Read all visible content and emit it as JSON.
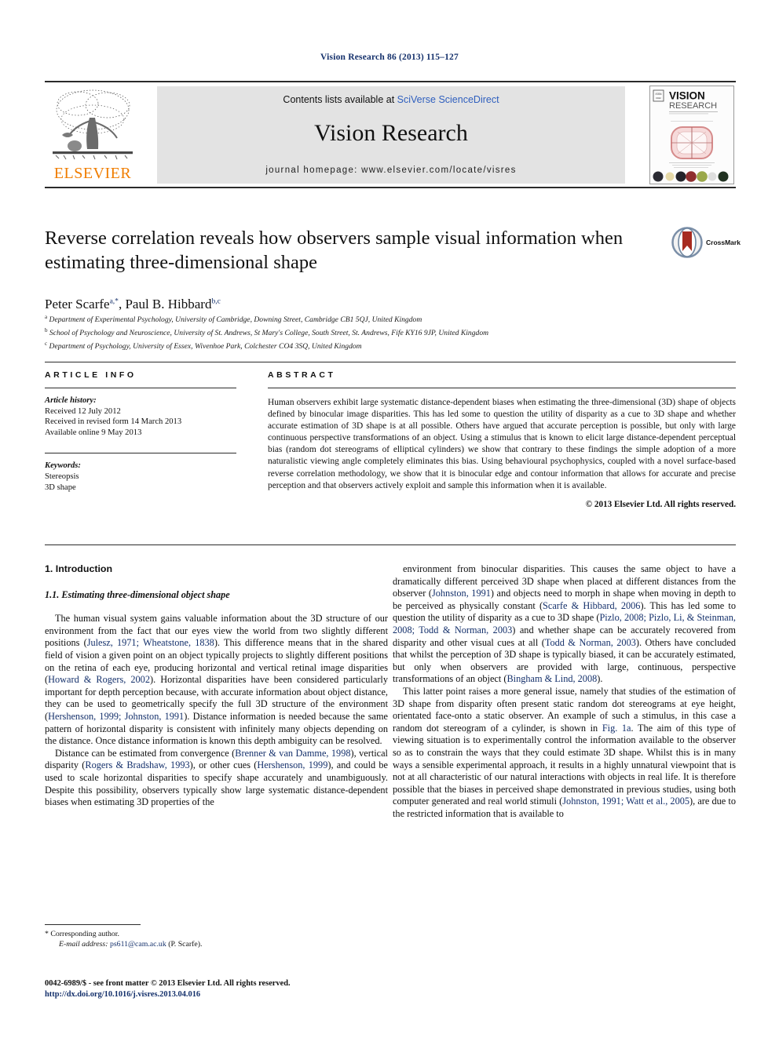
{
  "running_head": "Vision Research 86 (2013) 115–127",
  "masthead": {
    "elsevier_wordmark": "ELSEVIER",
    "contents_prefix": "Contents lists available at ",
    "contents_link": "SciVerse ScienceDirect",
    "journal_title": "Vision Research",
    "homepage": "journal homepage: www.elsevier.com/locate/visres",
    "cover": {
      "line1": "VISION",
      "line2": "RESEARCH",
      "tagline": "An international journal for functional aspects of vision"
    }
  },
  "article": {
    "title": "Reverse correlation reveals how observers sample visual information when estimating three-dimensional shape",
    "crossmark_label": "CrossMark",
    "authors": [
      {
        "name": "Peter Scarfe",
        "marks": "a,*"
      },
      {
        "name": "Paul B. Hibbard",
        "marks": "b,c"
      }
    ],
    "authors_line": "Peter Scarfe a,*, Paul B. Hibbard b,c",
    "affiliations": [
      {
        "mark": "a",
        "text": "Department of Experimental Psychology, University of Cambridge, Downing Street, Cambridge CB1 5QJ, United Kingdom"
      },
      {
        "mark": "b",
        "text": "School of Psychology and Neuroscience, University of St. Andrews, St Mary's College, South Street, St. Andrews, Fife KY16 9JP, United Kingdom"
      },
      {
        "mark": "c",
        "text": "Department of Psychology, University of Essex, Wivenhoe Park, Colchester CO4 3SQ, United Kingdom"
      }
    ]
  },
  "article_info": {
    "heading": "ARTICLE INFO",
    "history_label": "Article history:",
    "history": [
      "Received 12 July 2012",
      "Received in revised form 14 March 2013",
      "Available online 9 May 2013"
    ],
    "keywords_label": "Keywords:",
    "keywords": [
      "Stereopsis",
      "3D shape"
    ]
  },
  "abstract": {
    "heading": "ABSTRACT",
    "text": "Human observers exhibit large systematic distance-dependent biases when estimating the three-dimensional (3D) shape of objects defined by binocular image disparities. This has led some to question the utility of disparity as a cue to 3D shape and whether accurate estimation of 3D shape is at all possible. Others have argued that accurate perception is possible, but only with large continuous perspective transformations of an object. Using a stimulus that is known to elicit large distance-dependent perceptual bias (random dot stereograms of elliptical cylinders) we show that contrary to these findings the simple adoption of a more naturalistic viewing angle completely eliminates this bias. Using behavioural psychophysics, coupled with a novel surface-based reverse correlation methodology, we show that it is binocular edge and contour information that allows for accurate and precise perception and that observers actively exploit and sample this information when it is available.",
    "copyright": "© 2013 Elsevier Ltd. All rights reserved."
  },
  "body": {
    "section_number_title": "1. Introduction",
    "subsection_title": "1.1. Estimating three-dimensional object shape",
    "left_column": [
      {
        "segments": [
          {
            "t": "The human visual system gains valuable information about the 3D structure of our environment from the fact that our eyes view the world from two slightly different positions (",
            "ref": false
          },
          {
            "t": "Julesz, 1971; Wheatstone, 1838",
            "ref": true
          },
          {
            "t": "). This difference means that in the shared field of vision a given point on an object typically projects to slightly different positions on the retina of each eye, producing horizontal and vertical retinal image disparities (",
            "ref": false
          },
          {
            "t": "Howard & Rogers, 2002",
            "ref": true
          },
          {
            "t": "). Horizontal disparities have been considered particularly important for depth perception because, with accurate information about object distance, they can be used to geometrically specify the full 3D structure of the environment (",
            "ref": false
          },
          {
            "t": "Hershenson, 1999; Johnston, 1991",
            "ref": true
          },
          {
            "t": "). Distance information is needed because the same pattern of horizontal disparity is consistent with infinitely many objects depending on the distance. Once distance information is known this depth ambiguity can be resolved.",
            "ref": false
          }
        ]
      },
      {
        "segments": [
          {
            "t": "Distance can be estimated from convergence (",
            "ref": false
          },
          {
            "t": "Brenner & van Damme, 1998",
            "ref": true
          },
          {
            "t": "), vertical disparity (",
            "ref": false
          },
          {
            "t": "Rogers & Bradshaw, 1993",
            "ref": true
          },
          {
            "t": "), or other cues (",
            "ref": false
          },
          {
            "t": "Hershenson, 1999",
            "ref": true
          },
          {
            "t": "), and could be used to scale horizontal disparities to specify shape accurately and unambiguously. Despite this possibility, observers typically show large systematic distance-dependent biases when estimating 3D properties of the",
            "ref": false
          }
        ]
      }
    ],
    "right_column": [
      {
        "segments": [
          {
            "t": "environment from binocular disparities. This causes the same object to have a dramatically different perceived 3D shape when placed at different distances from the observer (",
            "ref": false
          },
          {
            "t": "Johnston, 1991",
            "ref": true
          },
          {
            "t": ") and objects need to morph in shape when moving in depth to be perceived as physically constant (",
            "ref": false
          },
          {
            "t": "Scarfe & Hibbard, 2006",
            "ref": true
          },
          {
            "t": "). This has led some to question the utility of disparity as a cue to 3D shape (",
            "ref": false
          },
          {
            "t": "Pizlo, 2008; Pizlo, Li, & Steinman, 2008; Todd & Norman, 2003",
            "ref": true
          },
          {
            "t": ") and whether shape can be accurately recovered from disparity and other visual cues at all (",
            "ref": false
          },
          {
            "t": "Todd & Norman, 2003",
            "ref": true
          },
          {
            "t": "). Others have concluded that whilst the perception of 3D shape is typically biased, it can be accurately estimated, but only when observers are provided with large, continuous, perspective transformations of an object (",
            "ref": false
          },
          {
            "t": "Bingham & Lind, 2008",
            "ref": true
          },
          {
            "t": ").",
            "ref": false
          }
        ]
      },
      {
        "segments": [
          {
            "t": "This latter point raises a more general issue, namely that studies of the estimation of 3D shape from disparity often present static random dot stereograms at eye height, orientated face-onto a static observer. An example of such a stimulus, in this case a random dot stereogram of a cylinder, is shown in ",
            "ref": false
          },
          {
            "t": "Fig. 1a",
            "ref": true
          },
          {
            "t": ". The aim of this type of viewing situation is to experimentally control the information available to the observer so as to constrain the ways that they could estimate 3D shape. Whilst this is in many ways a sensible experimental approach, it results in a highly unnatural viewpoint that is not at all characteristic of our natural interactions with objects in real life. It is therefore possible that the biases in perceived shape demonstrated in previous studies, using both computer generated and real world stimuli (",
            "ref": false
          },
          {
            "t": "Johnston, 1991; Watt et al., 2005",
            "ref": true
          },
          {
            "t": "), are due to the restricted information that is available to",
            "ref": false
          }
        ]
      }
    ]
  },
  "footnote": {
    "corresponding_mark": "*",
    "corresponding_text": "Corresponding author.",
    "email_label": "E-mail address:",
    "email": "ps611@cam.ac.uk",
    "email_owner": "(P. Scarfe)."
  },
  "footer": {
    "issn_line": "0042-6989/$ - see front matter © 2013 Elsevier Ltd. All rights reserved.",
    "doi_line": "http://dx.doi.org/10.1016/j.visres.2013.04.016"
  },
  "colors": {
    "link": "#2f5fbe",
    "reference": "#14306b",
    "elsevier_orange": "#f07d00",
    "band_gray": "#e3e3e3"
  }
}
